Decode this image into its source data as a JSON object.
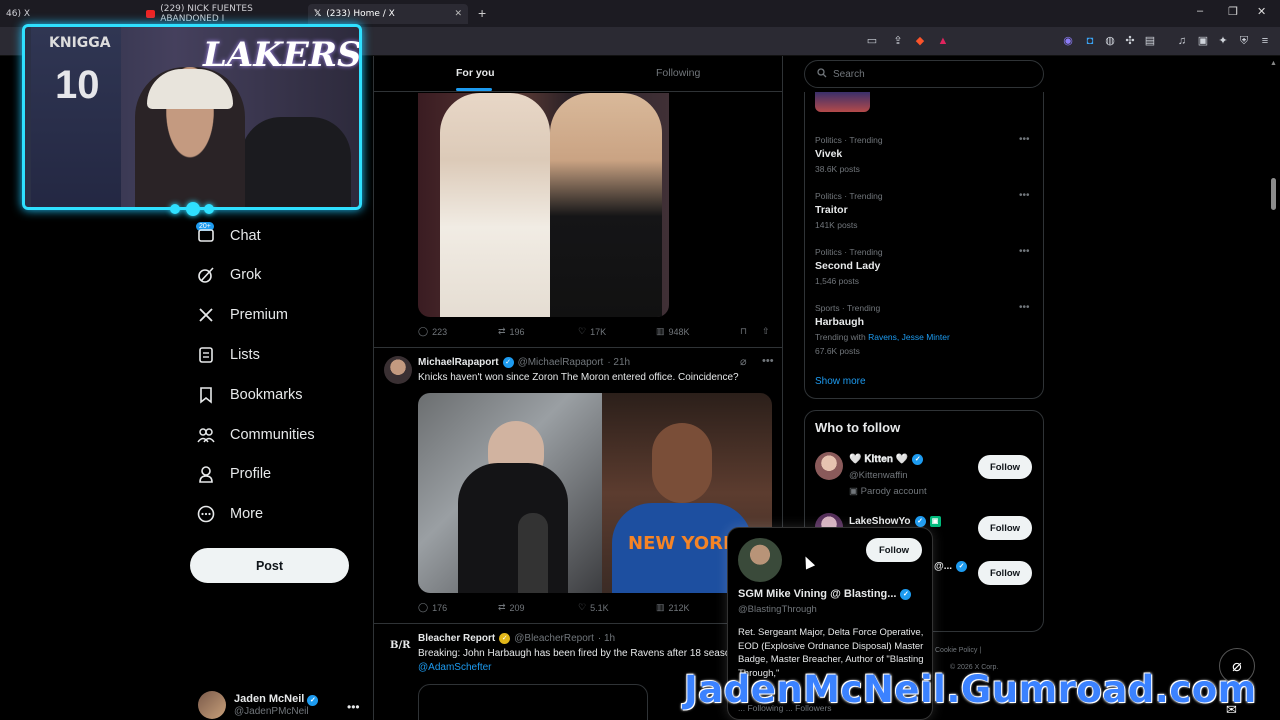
{
  "browser": {
    "tabs": [
      {
        "label": "46) X"
      },
      {
        "label": "(229) NICK FUENTES ABANDONED I"
      },
      {
        "label": "(233) Home / X",
        "active": true
      }
    ],
    "new_tab": "+",
    "window_controls": [
      "–",
      "❐",
      "✕"
    ]
  },
  "webcam": {
    "jersey_text": "KNIGGA",
    "jersey_number": "10",
    "banner": "LAKERS"
  },
  "nav": {
    "chat_badge": "20+",
    "items": [
      {
        "label": "Chat",
        "icon": "chat-icon"
      },
      {
        "label": "Grok",
        "icon": "grok-icon"
      },
      {
        "label": "Premium",
        "icon": "x-logo-icon"
      },
      {
        "label": "Lists",
        "icon": "lists-icon"
      },
      {
        "label": "Bookmarks",
        "icon": "bookmark-icon"
      },
      {
        "label": "Communities",
        "icon": "communities-icon"
      },
      {
        "label": "Profile",
        "icon": "profile-icon"
      },
      {
        "label": "More",
        "icon": "more-circle-icon"
      }
    ],
    "post_label": "Post",
    "account": {
      "name": "Jaden McNeil",
      "handle": "@JadenPMcNeil"
    }
  },
  "feed": {
    "tabs": {
      "for_you": "For you",
      "following": "Following"
    },
    "tweet1_actions": {
      "replies": "223",
      "reposts": "196",
      "likes": "17K",
      "views": "948K"
    },
    "tweet2": {
      "name": "MichaelRapaport",
      "handle": "@MichaelRapaport",
      "time": "· 21h",
      "text": "Knicks haven't won since Zoron The Moron entered office. Coincidence?",
      "actions": {
        "replies": "176",
        "reposts": "209",
        "likes": "5.1K",
        "views": "212K"
      },
      "image_text": "NEW YORK"
    },
    "tweet3": {
      "logo": "B/R",
      "name": "Bleacher Report",
      "handle": "@BleacherReport",
      "time": "· 1h",
      "text": "Breaking: John Harbaugh has been fired by the Ravens after 18 seaso",
      "mention": "@AdamSchefter"
    }
  },
  "sidebar": {
    "search_placeholder": "Search",
    "trends": [
      {
        "category": "Politics · Trending",
        "title": "Vivek",
        "count": "38.6K posts"
      },
      {
        "category": "Politics · Trending",
        "title": "Traitor",
        "count": "141K posts"
      },
      {
        "category": "Politics · Trending",
        "title": "Second Lady",
        "count": "1,546 posts"
      },
      {
        "category": "Sports · Trending",
        "title": "Harbaugh",
        "with_prefix": "Trending with",
        "with_links": "Ravens, Jesse Minter",
        "count": "67.6K posts"
      }
    ],
    "show_more": "Show more",
    "who_to_follow": {
      "title": "Who to follow",
      "accounts": [
        {
          "name": "🤍 𝐊𝐢𝐭𝐭𝐞𝐧 🤍",
          "handle": "@Kittenwaffin",
          "note": "Parody account"
        },
        {
          "name": "LakeShowYo",
          "handle": ""
        },
        {
          "name": "@...",
          "handle": ""
        }
      ],
      "follow_label": "Follow"
    },
    "footer": {
      "links": "Cookie Policy |",
      "corp": "© 2026 X Corp."
    }
  },
  "hover_card": {
    "name": "SGM Mike Vining @ Blasting...",
    "handle": "@BlastingThrough",
    "follow_label": "Follow",
    "bio": "Ret. Sergeant Major, Delta Force Operative, EOD (Explosive Ordnance Disposal) Master Badge, Master Breacher, Author of \"Blasting Through,\"",
    "stats": "... Following   ... Followers"
  },
  "watermark": "JadenMcNeil.Gumroad.com",
  "colors": {
    "accent": "#1d9bf0",
    "background": "#000000",
    "webcam_border": "#2fe0ff",
    "watermark": "#3b82ff"
  }
}
